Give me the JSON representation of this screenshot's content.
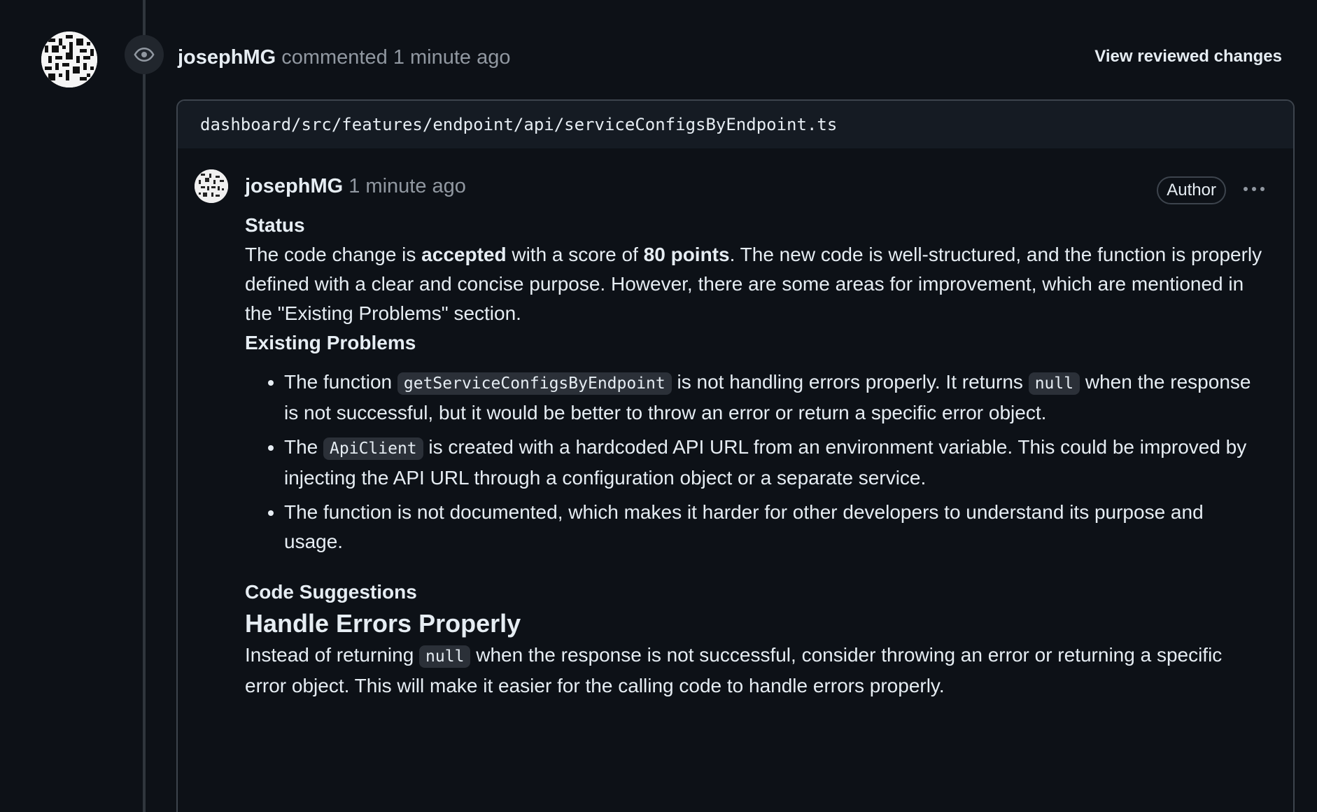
{
  "event": {
    "author": "josephMG",
    "action": "commented",
    "time": "1 minute ago",
    "view_changes_label": "View reviewed changes"
  },
  "file": {
    "path": "dashboard/src/features/endpoint/api/serviceConfigsByEndpoint.ts"
  },
  "comment": {
    "author": "josephMG",
    "time": "1 minute ago",
    "role_badge": "Author",
    "status_heading": "Status",
    "status": {
      "t1": "The code change is ",
      "b1": "accepted",
      "t2": " with a score of ",
      "b2": "80 points",
      "t3": ". The new code is well-structured, and the function is properly defined with a clear and concise purpose. However, there are some areas for improvement, which are mentioned in the \"Existing Problems\" section."
    },
    "problems_heading": "Existing Problems",
    "problems": [
      {
        "t1": "The function ",
        "c1": "getServiceConfigsByEndpoint",
        "t2": " is not handling errors properly. It returns ",
        "c2": "null",
        "t3": " when the response is not successful, but it would be better to throw an error or return a specific error object."
      },
      {
        "t1": "The ",
        "c1": "ApiClient",
        "t2": " is created with a hardcoded API URL from an environment variable. This could be improved by injecting the API URL through a configuration object or a separate service."
      },
      {
        "t1": "The function is not documented, which makes it harder for other developers to understand its purpose and usage."
      }
    ],
    "suggestions_heading": "Code Suggestions",
    "suggestion_title": "Handle Errors Properly",
    "suggestion_text": {
      "t1": "Instead of returning ",
      "c1": "null",
      "t2": " when the response is not successful, consider throwing an error or returning a specific error object. This will make it easier for the calling code to handle errors properly."
    }
  },
  "icons": {
    "review_state": "eye-icon",
    "menu": "kebab-horizontal-icon"
  },
  "colors": {
    "background": "#0d1117",
    "muted_text": "#9198a1",
    "border": "#3d444d",
    "file_header_bg": "#151b23",
    "code_bg": "#2b3038"
  }
}
